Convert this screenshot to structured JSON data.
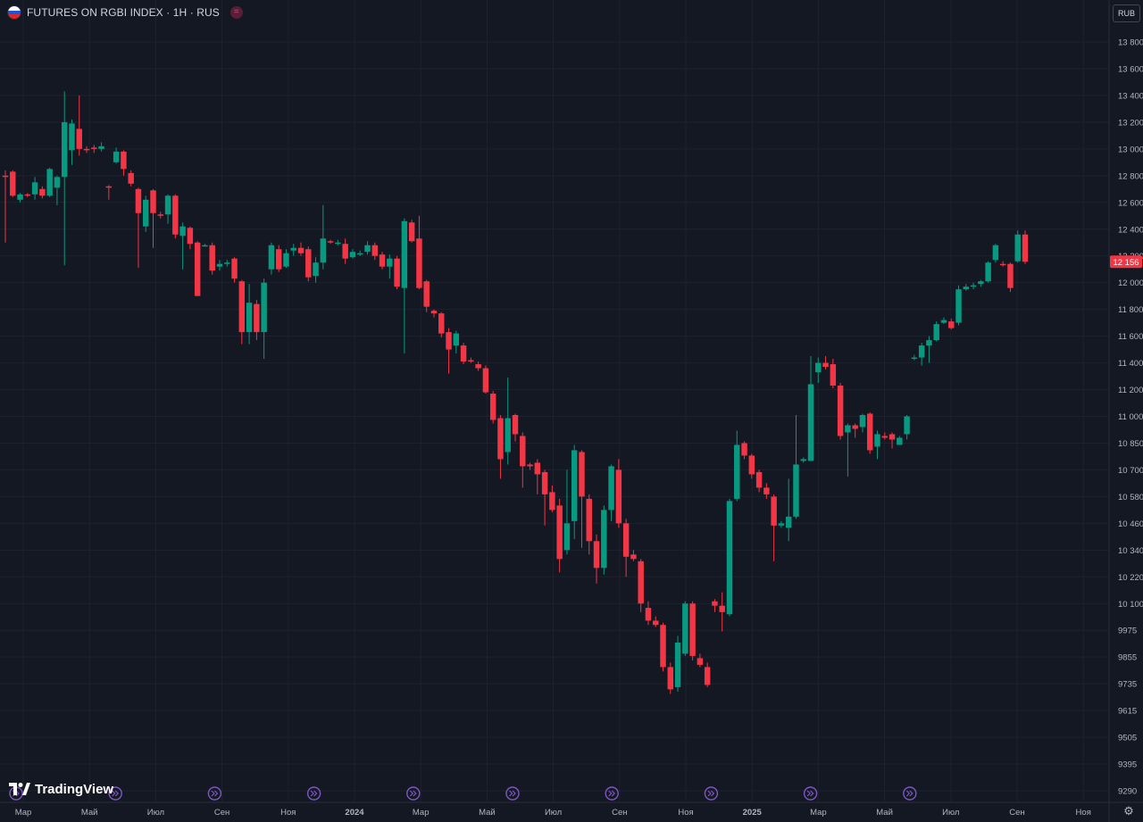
{
  "header": {
    "title": "FUTURES ON RGBI INDEX · 1H · RUS",
    "flag_icon": "russia-flag-icon",
    "menu_icon": "equals-icon"
  },
  "currency": "RUB",
  "branding": {
    "logo_text": "TradingView",
    "logo_icon": "tradingview-logo-icon"
  },
  "colors": {
    "background": "#141823",
    "up": "#089981",
    "down": "#f23645",
    "grid": "#1e2230",
    "price_tag": "#f23645",
    "event": "#7e57c2"
  },
  "chart_data": {
    "type": "candlestick",
    "symbol": "FUTURES ON RGBI INDEX",
    "interval": "1H",
    "last_price": 12156,
    "last_price_label": "12 156",
    "y_ticks": [
      "13 800",
      "13 600",
      "13 400",
      "13 200",
      "13 000",
      "12 800",
      "12 600",
      "12 400",
      "12 200",
      "12 000",
      "11 800",
      "11 600",
      "11 400",
      "11 200",
      "11 000",
      "10 850",
      "10 700",
      "10 580",
      "10 460",
      "10 340",
      "10 220",
      "10 100",
      "9975",
      "9855",
      "9735",
      "9615",
      "9505",
      "9395",
      "9290"
    ],
    "x_ticks": [
      "Мар",
      "Май",
      "Июл",
      "Сен",
      "Ноя",
      "2024",
      "Мар",
      "Май",
      "Июл",
      "Сен",
      "Ноя",
      "2025",
      "Мар",
      "Май",
      "Июл",
      "Сен",
      "Ноя"
    ],
    "bold_x_ticks": [
      "2024",
      "2025"
    ],
    "event_markers": 10,
    "candles": [
      [
        12800,
        12790,
        12840,
        12300
      ],
      [
        12830,
        12650,
        12840,
        12640
      ],
      [
        12620,
        12660,
        12670,
        12600
      ],
      [
        12660,
        12650,
        12670,
        12640
      ],
      [
        12660,
        12750,
        12790,
        12620
      ],
      [
        12700,
        12650,
        12720,
        12630
      ],
      [
        12650,
        12850,
        12860,
        12640
      ],
      [
        12710,
        12790,
        12800,
        12580
      ],
      [
        12790,
        13200,
        13430,
        12130
      ],
      [
        12990,
        13190,
        13220,
        12880
      ],
      [
        13150,
        13000,
        13400,
        12950
      ],
      [
        13000,
        12990,
        13020,
        12970
      ],
      [
        13010,
        13000,
        13030,
        12970
      ],
      [
        13000,
        13020,
        13050,
        12980
      ],
      [
        12720,
        12710,
        12730,
        12620
      ],
      [
        12900,
        12980,
        13010,
        12890
      ],
      [
        12980,
        12850,
        12990,
        12800
      ],
      [
        12820,
        12740,
        12840,
        12720
      ],
      [
        12700,
        12520,
        12710,
        12110
      ],
      [
        12420,
        12620,
        12650,
        12380
      ],
      [
        12690,
        12520,
        12700,
        12260
      ],
      [
        12510,
        12500,
        12530,
        12480
      ],
      [
        12510,
        12650,
        12660,
        12440
      ],
      [
        12650,
        12360,
        12660,
        12330
      ],
      [
        12350,
        12420,
        12450,
        12100
      ],
      [
        12410,
        12290,
        12420,
        12250
      ],
      [
        12300,
        11900,
        12310,
        11900
      ],
      [
        12280,
        12280,
        12290,
        12270
      ],
      [
        12280,
        12090,
        12300,
        12060
      ],
      [
        12120,
        12140,
        12170,
        12090
      ],
      [
        12140,
        12150,
        12170,
        12120
      ],
      [
        12180,
        12030,
        12190,
        12000
      ],
      [
        12010,
        11630,
        12020,
        11540
      ],
      [
        11630,
        11850,
        11990,
        11540
      ],
      [
        11840,
        11630,
        11870,
        11570
      ],
      [
        11630,
        12000,
        12030,
        11430
      ],
      [
        12100,
        12280,
        12300,
        12060
      ],
      [
        12250,
        12100,
        12280,
        12080
      ],
      [
        12120,
        12220,
        12250,
        12110
      ],
      [
        12240,
        12260,
        12290,
        12200
      ],
      [
        12260,
        12220,
        12300,
        12200
      ],
      [
        12250,
        12040,
        12270,
        12010
      ],
      [
        12050,
        12150,
        12190,
        12000
      ],
      [
        12150,
        12330,
        12580,
        12100
      ],
      [
        12310,
        12300,
        12320,
        12290
      ],
      [
        12300,
        12300,
        12320,
        12280
      ],
      [
        12290,
        12180,
        12330,
        12140
      ],
      [
        12190,
        12230,
        12250,
        12180
      ],
      [
        12220,
        12220,
        12240,
        12200
      ],
      [
        12230,
        12280,
        12310,
        12210
      ],
      [
        12280,
        12200,
        12300,
        12170
      ],
      [
        12210,
        12120,
        12230,
        12100
      ],
      [
        12120,
        12180,
        12210,
        12030
      ],
      [
        12180,
        11970,
        12200,
        11950
      ],
      [
        11960,
        12460,
        12480,
        11470
      ],
      [
        12450,
        12310,
        12470,
        12300
      ],
      [
        12330,
        11960,
        12500,
        11950
      ],
      [
        12010,
        11820,
        12020,
        11780
      ],
      [
        11790,
        11770,
        11800,
        11740
      ],
      [
        11770,
        11620,
        11780,
        11590
      ],
      [
        11630,
        11500,
        11660,
        11320
      ],
      [
        11530,
        11620,
        11640,
        11470
      ],
      [
        11530,
        11410,
        11550,
        11390
      ],
      [
        11420,
        11410,
        11440,
        11400
      ],
      [
        11390,
        11360,
        11410,
        11340
      ],
      [
        11360,
        11180,
        11380,
        11170
      ],
      [
        11170,
        10980,
        11190,
        10960
      ],
      [
        10990,
        10760,
        11010,
        10660
      ],
      [
        10800,
        10990,
        11290,
        10730
      ],
      [
        11010,
        10900,
        11020,
        10860
      ],
      [
        10890,
        10720,
        10910,
        10620
      ],
      [
        10730,
        10720,
        10740,
        10700
      ],
      [
        10740,
        10680,
        10760,
        10590
      ],
      [
        10690,
        10590,
        10700,
        10450
      ],
      [
        10600,
        10520,
        10630,
        10510
      ],
      [
        10540,
        10300,
        10570,
        10240
      ],
      [
        10340,
        10460,
        10700,
        10320
      ],
      [
        10470,
        10810,
        10840,
        10390
      ],
      [
        10800,
        10580,
        10810,
        10350
      ],
      [
        10570,
        10380,
        10590,
        10320
      ],
      [
        10380,
        10260,
        10410,
        10190
      ],
      [
        10260,
        10520,
        10540,
        10230
      ],
      [
        10520,
        10720,
        10730,
        10470
      ],
      [
        10700,
        10460,
        10760,
        10440
      ],
      [
        10460,
        10310,
        10480,
        10220
      ],
      [
        10320,
        10300,
        10340,
        10290
      ],
      [
        10290,
        10100,
        10300,
        10060
      ],
      [
        10080,
        10020,
        10110,
        10000
      ],
      [
        10020,
        10000,
        10040,
        9990
      ],
      [
        10000,
        9810,
        10010,
        9790
      ],
      [
        9810,
        9710,
        9830,
        9690
      ],
      [
        9720,
        9920,
        9950,
        9700
      ],
      [
        9870,
        10100,
        10110,
        9860
      ],
      [
        10100,
        9860,
        10110,
        9840
      ],
      [
        9850,
        9820,
        9870,
        9810
      ],
      [
        9810,
        9730,
        9830,
        9720
      ],
      [
        10110,
        10090,
        10120,
        10060
      ],
      [
        10090,
        10060,
        10150,
        9970
      ],
      [
        10050,
        10560,
        10570,
        10040
      ],
      [
        10570,
        10840,
        10920,
        10560
      ],
      [
        10850,
        10780,
        10860,
        10760
      ],
      [
        10780,
        10680,
        10790,
        10660
      ],
      [
        10690,
        10620,
        10700,
        10600
      ],
      [
        10620,
        10590,
        10640,
        10570
      ],
      [
        10580,
        10450,
        10590,
        10290
      ],
      [
        10450,
        10460,
        10470,
        10440
      ],
      [
        10440,
        10490,
        10660,
        10380
      ],
      [
        10490,
        10730,
        11010,
        10480
      ],
      [
        10750,
        10760,
        10770,
        10740
      ],
      [
        10750,
        11240,
        11450,
        11170
      ],
      [
        11330,
        11400,
        11440,
        11250
      ],
      [
        11400,
        11370,
        11450,
        11350
      ],
      [
        11390,
        11230,
        11430,
        11210
      ],
      [
        11230,
        10890,
        11250,
        10870
      ],
      [
        10910,
        10950,
        10960,
        10670
      ],
      [
        10950,
        10930,
        10960,
        10880
      ],
      [
        10940,
        11010,
        11020,
        10910
      ],
      [
        11020,
        10810,
        11030,
        10790
      ],
      [
        10830,
        10900,
        10920,
        10760
      ],
      [
        10890,
        10880,
        10910,
        10870
      ],
      [
        10900,
        10870,
        10910,
        10820
      ],
      [
        10840,
        10880,
        10890,
        10860
      ],
      [
        10900,
        11000,
        11010,
        10870
      ],
      [
        11430,
        11440,
        11460,
        11420
      ],
      [
        11440,
        11530,
        11550,
        11380
      ],
      [
        11530,
        11570,
        11600,
        11400
      ],
      [
        11570,
        11690,
        11710,
        11560
      ],
      [
        11700,
        11720,
        11740,
        11690
      ],
      [
        11710,
        11660,
        11730,
        11650
      ],
      [
        11700,
        11950,
        11980,
        11680
      ],
      [
        11950,
        11970,
        11990,
        11940
      ],
      [
        11970,
        11980,
        12000,
        11950
      ],
      [
        11990,
        12010,
        12020,
        11970
      ],
      [
        12010,
        12150,
        12160,
        12000
      ],
      [
        12170,
        12280,
        12290,
        12150
      ],
      [
        12140,
        12130,
        12160,
        12120
      ],
      [
        12140,
        11960,
        12150,
        11930
      ],
      [
        12160,
        12360,
        12390,
        12150
      ],
      [
        12360,
        12156,
        12390,
        12140
      ]
    ]
  }
}
